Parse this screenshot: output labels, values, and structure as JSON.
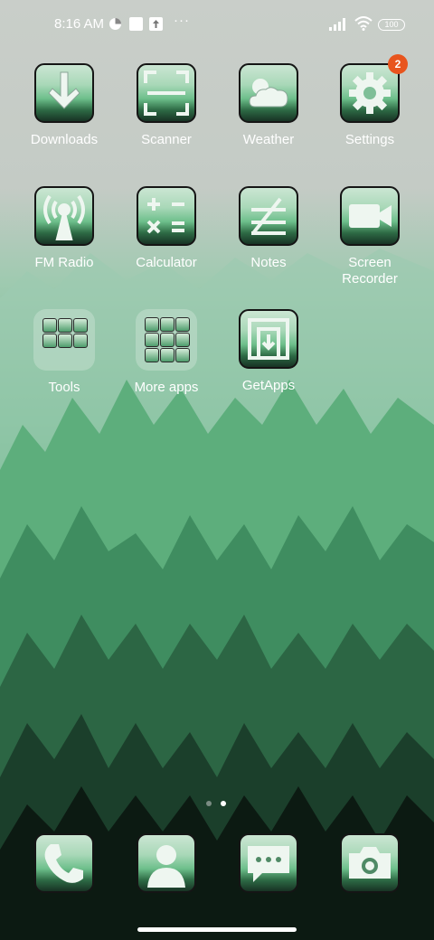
{
  "status_bar": {
    "time": "8:16 AM",
    "more": "···",
    "battery": "100"
  },
  "apps": [
    {
      "label": "Downloads",
      "icon": "download-icon"
    },
    {
      "label": "Scanner",
      "icon": "scanner-icon"
    },
    {
      "label": "Weather",
      "icon": "weather-icon"
    },
    {
      "label": "Settings",
      "icon": "gear-icon",
      "badge": "2"
    },
    {
      "label": "FM Radio",
      "icon": "radio-icon"
    },
    {
      "label": "Calculator",
      "icon": "calculator-icon"
    },
    {
      "label": "Notes",
      "icon": "notes-icon"
    },
    {
      "label": "Screen\nRecorder",
      "icon": "screen-recorder-icon"
    },
    {
      "label": "Tools",
      "icon": "folder-icon"
    },
    {
      "label": "More apps",
      "icon": "folder-icon"
    },
    {
      "label": "GetApps",
      "icon": "getapps-icon"
    }
  ],
  "dock": [
    {
      "icon": "phone-icon"
    },
    {
      "icon": "contacts-icon"
    },
    {
      "icon": "messages-icon"
    },
    {
      "icon": "camera-icon"
    }
  ],
  "pager": {
    "pages": 2,
    "active_page": 2
  },
  "colors": {
    "badge": "#e8551e",
    "icon_border": "#151515"
  }
}
